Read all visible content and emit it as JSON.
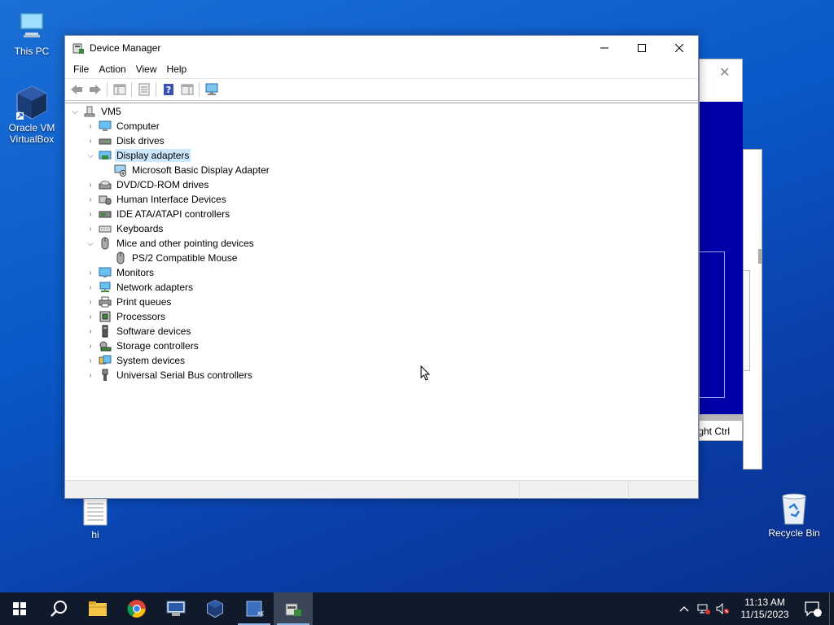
{
  "desktop": {
    "icons": [
      {
        "label": "This PC"
      },
      {
        "label": "Oracle VM VirtualBox"
      },
      {
        "label": "hi"
      },
      {
        "label": "Recycle Bin"
      }
    ]
  },
  "bg_window": {
    "status_text": "ght Ctrl"
  },
  "window": {
    "title": "Device Manager",
    "menu": [
      "File",
      "Action",
      "View",
      "Help"
    ],
    "tree": {
      "root": "VM5",
      "items": [
        {
          "label": "Computer",
          "expanded": false
        },
        {
          "label": "Disk drives",
          "expanded": false
        },
        {
          "label": "Display adapters",
          "expanded": true,
          "selected": true
        },
        {
          "label": "Microsoft Basic Display Adapter",
          "child": true
        },
        {
          "label": "DVD/CD-ROM drives",
          "expanded": false
        },
        {
          "label": "Human Interface Devices",
          "expanded": false
        },
        {
          "label": "IDE ATA/ATAPI controllers",
          "expanded": false
        },
        {
          "label": "Keyboards",
          "expanded": false
        },
        {
          "label": "Mice and other pointing devices",
          "expanded": true
        },
        {
          "label": "PS/2 Compatible Mouse",
          "child": true
        },
        {
          "label": "Monitors",
          "expanded": false
        },
        {
          "label": "Network adapters",
          "expanded": false
        },
        {
          "label": "Print queues",
          "expanded": false
        },
        {
          "label": "Processors",
          "expanded": false
        },
        {
          "label": "Software devices",
          "expanded": false
        },
        {
          "label": "Storage controllers",
          "expanded": false
        },
        {
          "label": "System devices",
          "expanded": false
        },
        {
          "label": "Universal Serial Bus controllers",
          "expanded": false
        }
      ]
    }
  },
  "taskbar": {
    "time": "11:13 AM",
    "date": "11/15/2023",
    "notification_count": "1"
  },
  "colors": {
    "selection": "#cce8ff",
    "taskbar": "#101a2b",
    "desktop": "#0a58c9"
  }
}
